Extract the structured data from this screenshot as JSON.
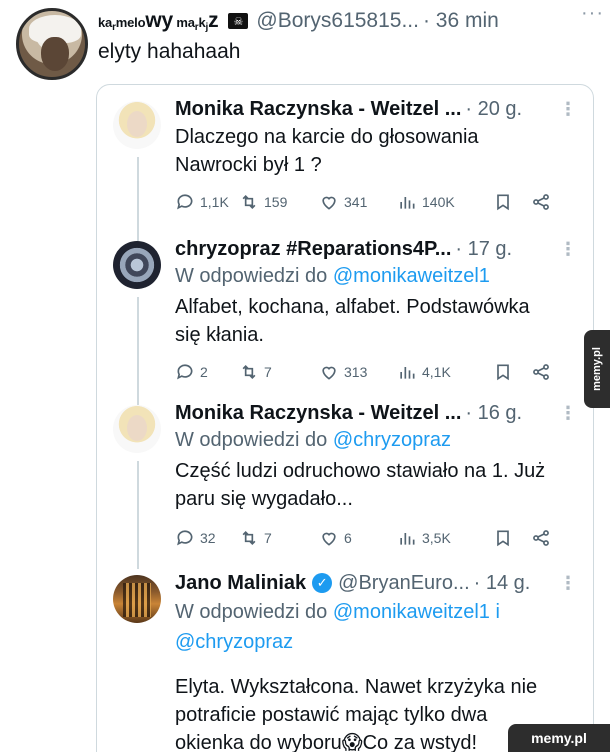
{
  "outer": {
    "name_parts": {
      "a": "ka",
      "b": "r",
      "c": "melo",
      "d": "wy",
      "e": " ma",
      "f": "r",
      "g": "k",
      "h": "j",
      "i": "z"
    },
    "pirate_icon": "pirate-flag-icon",
    "handle": "@Borys615815...",
    "time": "· 36 min",
    "text": "elyty hahahaah"
  },
  "replies": [
    {
      "name": "Monika Raczynska - Weitzel ...",
      "time": "· 20 g.",
      "body_lines": [
        "Dlaczego na karcie do głosowania",
        "Nawrocki był 1 ?"
      ],
      "stats": {
        "comments": "1,1K",
        "retweets": "159",
        "likes": "341",
        "views": "140K"
      }
    },
    {
      "name": "chryzopraz #Reparations4P...",
      "time": "· 17 g.",
      "reply_to_prefix": "W odpowiedzi do ",
      "reply_to": "@monikaweitzel1",
      "body_lines": [
        "Alfabet, kochana, alfabet. Podstawówka",
        "się kłania."
      ],
      "stats": {
        "comments": "2",
        "retweets": "7",
        "likes": "313",
        "views": "4,1K"
      }
    },
    {
      "name": "Monika Raczynska - Weitzel ...",
      "time": "· 16 g.",
      "reply_to_prefix": "W odpowiedzi do ",
      "reply_to": "@chryzopraz",
      "body_lines": [
        "Część ludzi odruchowo stawiało na 1. Już",
        "paru się wygadało..."
      ],
      "stats": {
        "comments": "32",
        "retweets": "7",
        "likes": "6",
        "views": "3,5K"
      }
    },
    {
      "name": "Jano Maliniak",
      "verified_icon": "verified-badge-icon",
      "handle": "@BryanEuro...",
      "time": "· 14 g.",
      "reply_to_prefix": "W odpowiedzi do ",
      "reply_to": "@monikaweitzel1",
      "reply_to_and": " i",
      "reply_to_2": "@chryzopraz",
      "body_lines": [
        "Elyta. Wykształcona. Nawet krzyżyka nie",
        "potraficie postawić mając tylko dwa",
        "okienka do wyboru😱Co za wstyd!"
      ]
    }
  ],
  "watermarks": {
    "side": "memy.pl",
    "corner": "memy.pl"
  },
  "colors": {
    "link": "#1d9bf0",
    "muted": "#536471",
    "border": "#cfd9de",
    "verified": "#1d9bf0"
  }
}
